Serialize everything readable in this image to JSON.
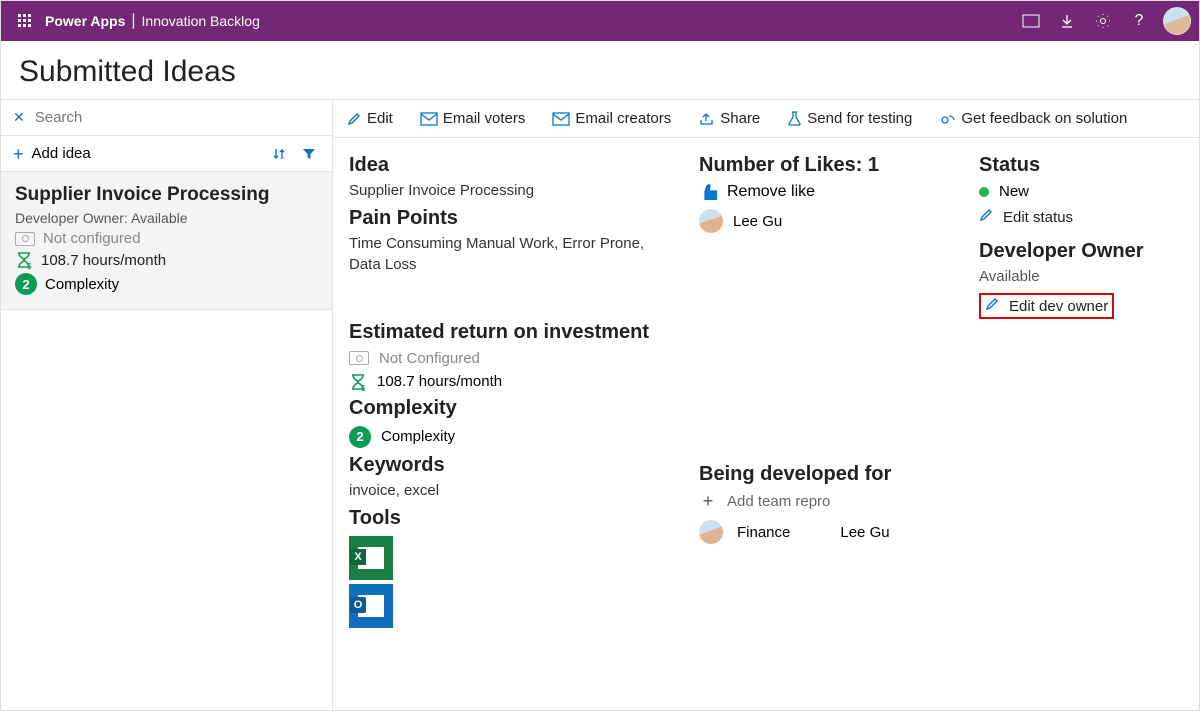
{
  "header": {
    "brand": "Power Apps",
    "app": "Innovation Backlog"
  },
  "page_title": "Submitted Ideas",
  "search": {
    "placeholder": "Search"
  },
  "add_idea_label": "Add idea",
  "list": {
    "items": [
      {
        "title": "Supplier Invoice Processing",
        "owner_line": "Developer Owner: Available",
        "configured": "Not configured",
        "hours": "108.7 hours/month",
        "complexity_badge": "2",
        "complexity_label": "Complexity"
      }
    ]
  },
  "toolbar": {
    "edit": "Edit",
    "email_voters": "Email voters",
    "email_creators": "Email creators",
    "share": "Share",
    "send_testing": "Send for testing",
    "get_feedback": "Get feedback on solution"
  },
  "detail": {
    "idea_h": "Idea",
    "idea_title": "Supplier Invoice Processing",
    "pain_h": "Pain Points",
    "pain_text": "Time Consuming Manual Work, Error Prone, Data Loss",
    "roi_h": "Estimated return on investment",
    "roi_configured": "Not Configured",
    "roi_hours": "108.7 hours/month",
    "complexity_h": "Complexity",
    "complexity_badge": "2",
    "complexity_label": "Complexity",
    "keywords_h": "Keywords",
    "keywords": "invoice, excel",
    "tools_h": "Tools"
  },
  "likes": {
    "heading": "Number of Likes: 1",
    "remove": "Remove like",
    "user": "Lee Gu"
  },
  "developed": {
    "heading": "Being developed for",
    "add": "Add team repro",
    "team": "Finance",
    "person": "Lee Gu"
  },
  "status": {
    "heading": "Status",
    "value": "New",
    "edit": "Edit status",
    "dev_owner_h": "Developer Owner",
    "dev_owner_value": "Available",
    "edit_dev": "Edit dev owner"
  }
}
